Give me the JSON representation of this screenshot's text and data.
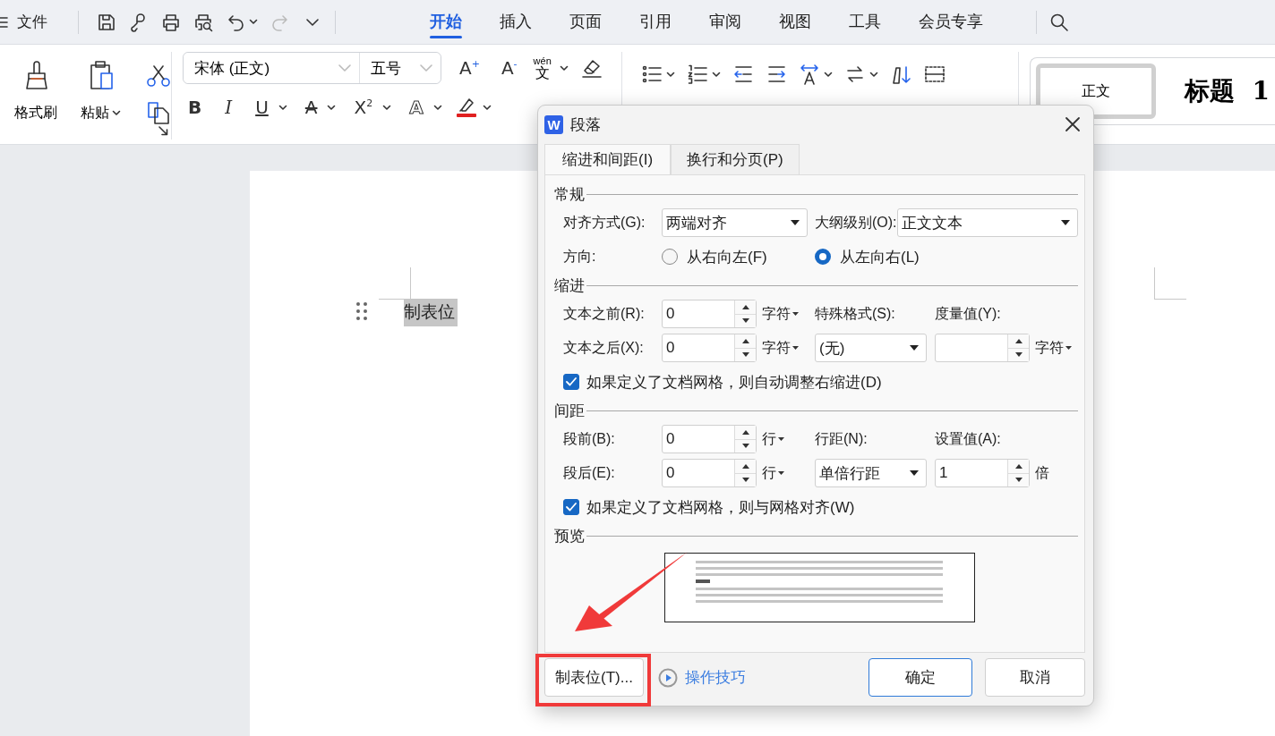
{
  "menu_bar": {
    "file_label": "文件",
    "quick_access": [
      {
        "kind": "save",
        "disabled": false,
        "dropdown": false
      },
      {
        "kind": "hook",
        "disabled": false,
        "dropdown": false
      },
      {
        "kind": "print",
        "disabled": false,
        "dropdown": false
      },
      {
        "kind": "preview",
        "disabled": false,
        "dropdown": false
      },
      {
        "kind": "undo",
        "disabled": false,
        "dropdown": true
      },
      {
        "kind": "redo",
        "disabled": true,
        "dropdown": false
      },
      {
        "kind": "more",
        "disabled": false,
        "dropdown": false
      }
    ],
    "tabs": [
      {
        "label": "开始",
        "selected": true
      },
      {
        "label": "插入",
        "selected": false
      },
      {
        "label": "页面",
        "selected": false
      },
      {
        "label": "引用",
        "selected": false
      },
      {
        "label": "审阅",
        "selected": false
      },
      {
        "label": "视图",
        "selected": false
      },
      {
        "label": "工具",
        "selected": false
      },
      {
        "label": "会员专享",
        "selected": false
      }
    ]
  },
  "ribbon": {
    "format_painter": "格式刷",
    "paste": "粘贴",
    "font_family": "宋体 (正文)",
    "font_size": "五号",
    "size_buttons": [
      {
        "label": "A$^{+}$"
      },
      {
        "label": "A$^{-}$"
      }
    ],
    "phonetic": {
      "pinyin": "wén",
      "char": "文"
    },
    "format_buttons": [
      {
        "kind": "bold",
        "label": "B",
        "dropdown": false
      },
      {
        "kind": "italic",
        "label": "I",
        "dropdown": false
      },
      {
        "kind": "underline",
        "label": "U",
        "dropdown": true
      },
      {
        "kind": "strike",
        "label": "A",
        "dropdown": true
      },
      {
        "kind": "superscript",
        "label": "X$^{2}$",
        "dropdown": true
      },
      {
        "kind": "effect",
        "label": "A",
        "dropdown": true
      }
    ],
    "styles": [
      {
        "kind": "body",
        "label": "正文",
        "selected": true
      },
      {
        "kind": "heading",
        "label": "标题  1",
        "selected": false
      }
    ]
  },
  "document": {
    "text": "制表位"
  },
  "dialog": {
    "logo": "W",
    "title": "段落",
    "tabs": [
      {
        "label": "缩进和间距(I)",
        "selected": true
      },
      {
        "label": "换行和分页(P)",
        "selected": false
      }
    ],
    "general": {
      "title": "常规",
      "alignment_label": "对齐方式(G):",
      "alignment": "两端对齐",
      "outline_label": "大纲级别(O):",
      "outline": "正文文本",
      "direction_label": "方向:",
      "directions": [
        {
          "label": "从右向左(F)",
          "selected": false
        },
        {
          "label": "从左向右(L)",
          "selected": true
        }
      ]
    },
    "indent": {
      "title": "缩进",
      "before_label": "文本之前(R):",
      "before": "0",
      "before_unit": {
        "label": "字符",
        "dropdown": true
      },
      "special_label": "特殊格式(S):",
      "measure_label": "度量值(Y):",
      "after_label": "文本之后(X):",
      "after": "0",
      "after_unit": {
        "label": "字符",
        "dropdown": true
      },
      "special": "(无)",
      "measure_unit": {
        "label": "字符",
        "dropdown": true
      },
      "grid_option": {
        "label": "如果定义了文档网格，则自动调整右缩进(D)",
        "checked": true
      }
    },
    "spacing": {
      "title": "间距",
      "before_label": "段前(B):",
      "before": "0",
      "before_unit": {
        "label": "行",
        "dropdown": true
      },
      "line_label": "行距(N):",
      "value_label": "设置值(A):",
      "after_label": "段后(E):",
      "after": "0",
      "after_unit": {
        "label": "行",
        "dropdown": true
      },
      "line": "单倍行距",
      "value": "1",
      "value_unit": {
        "label": "倍",
        "dropdown": false
      },
      "grid_option": {
        "label": "如果定义了文档网格，则与网格对齐(W)",
        "checked": true
      }
    },
    "preview": {
      "title": "预览"
    },
    "tabs_button": "制表位(T)...",
    "tips_link": "操作技巧",
    "ok": "确定",
    "cancel": "取消"
  },
  "annotations": [
    {
      "kind": "arrow"
    },
    {
      "kind": "frame"
    }
  ]
}
